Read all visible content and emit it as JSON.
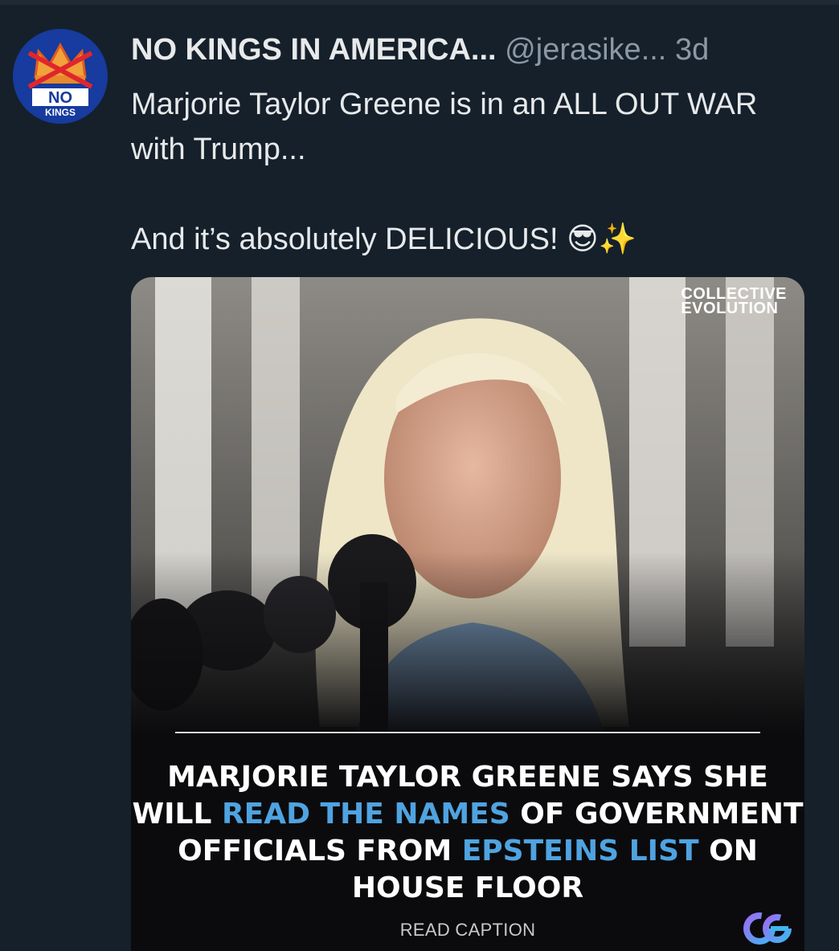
{
  "tweet": {
    "display_name": "NO KINGS IN AMERICA...",
    "handle": "@jerasike...",
    "separator": "",
    "time": "3d",
    "text": "Marjorie Taylor Greene is in an ALL OUT WAR with Trump...\n\nAnd it’s absolutely DELICIOUS! 😎✨"
  },
  "avatar": {
    "label_top": "NO",
    "label_bottom": "KINGS",
    "icon": "crown-icon"
  },
  "media": {
    "brand_line1": "COLLECTIVE",
    "brand_line2": "EVOLUTION",
    "headline": {
      "part1": "MARJORIE TAYLOR GREENE SAYS SHE WILL ",
      "highlight1": "READ THE NAMES",
      "part2": " OF GOVERNMENT OFFICIALS FROM ",
      "highlight2": "EPSTEINS LIST",
      "part3": " ON HOUSE FLOOR"
    },
    "caption_link": "READ CAPTION",
    "logo_text": "ce",
    "highlight_color": "#4fa3e0"
  }
}
